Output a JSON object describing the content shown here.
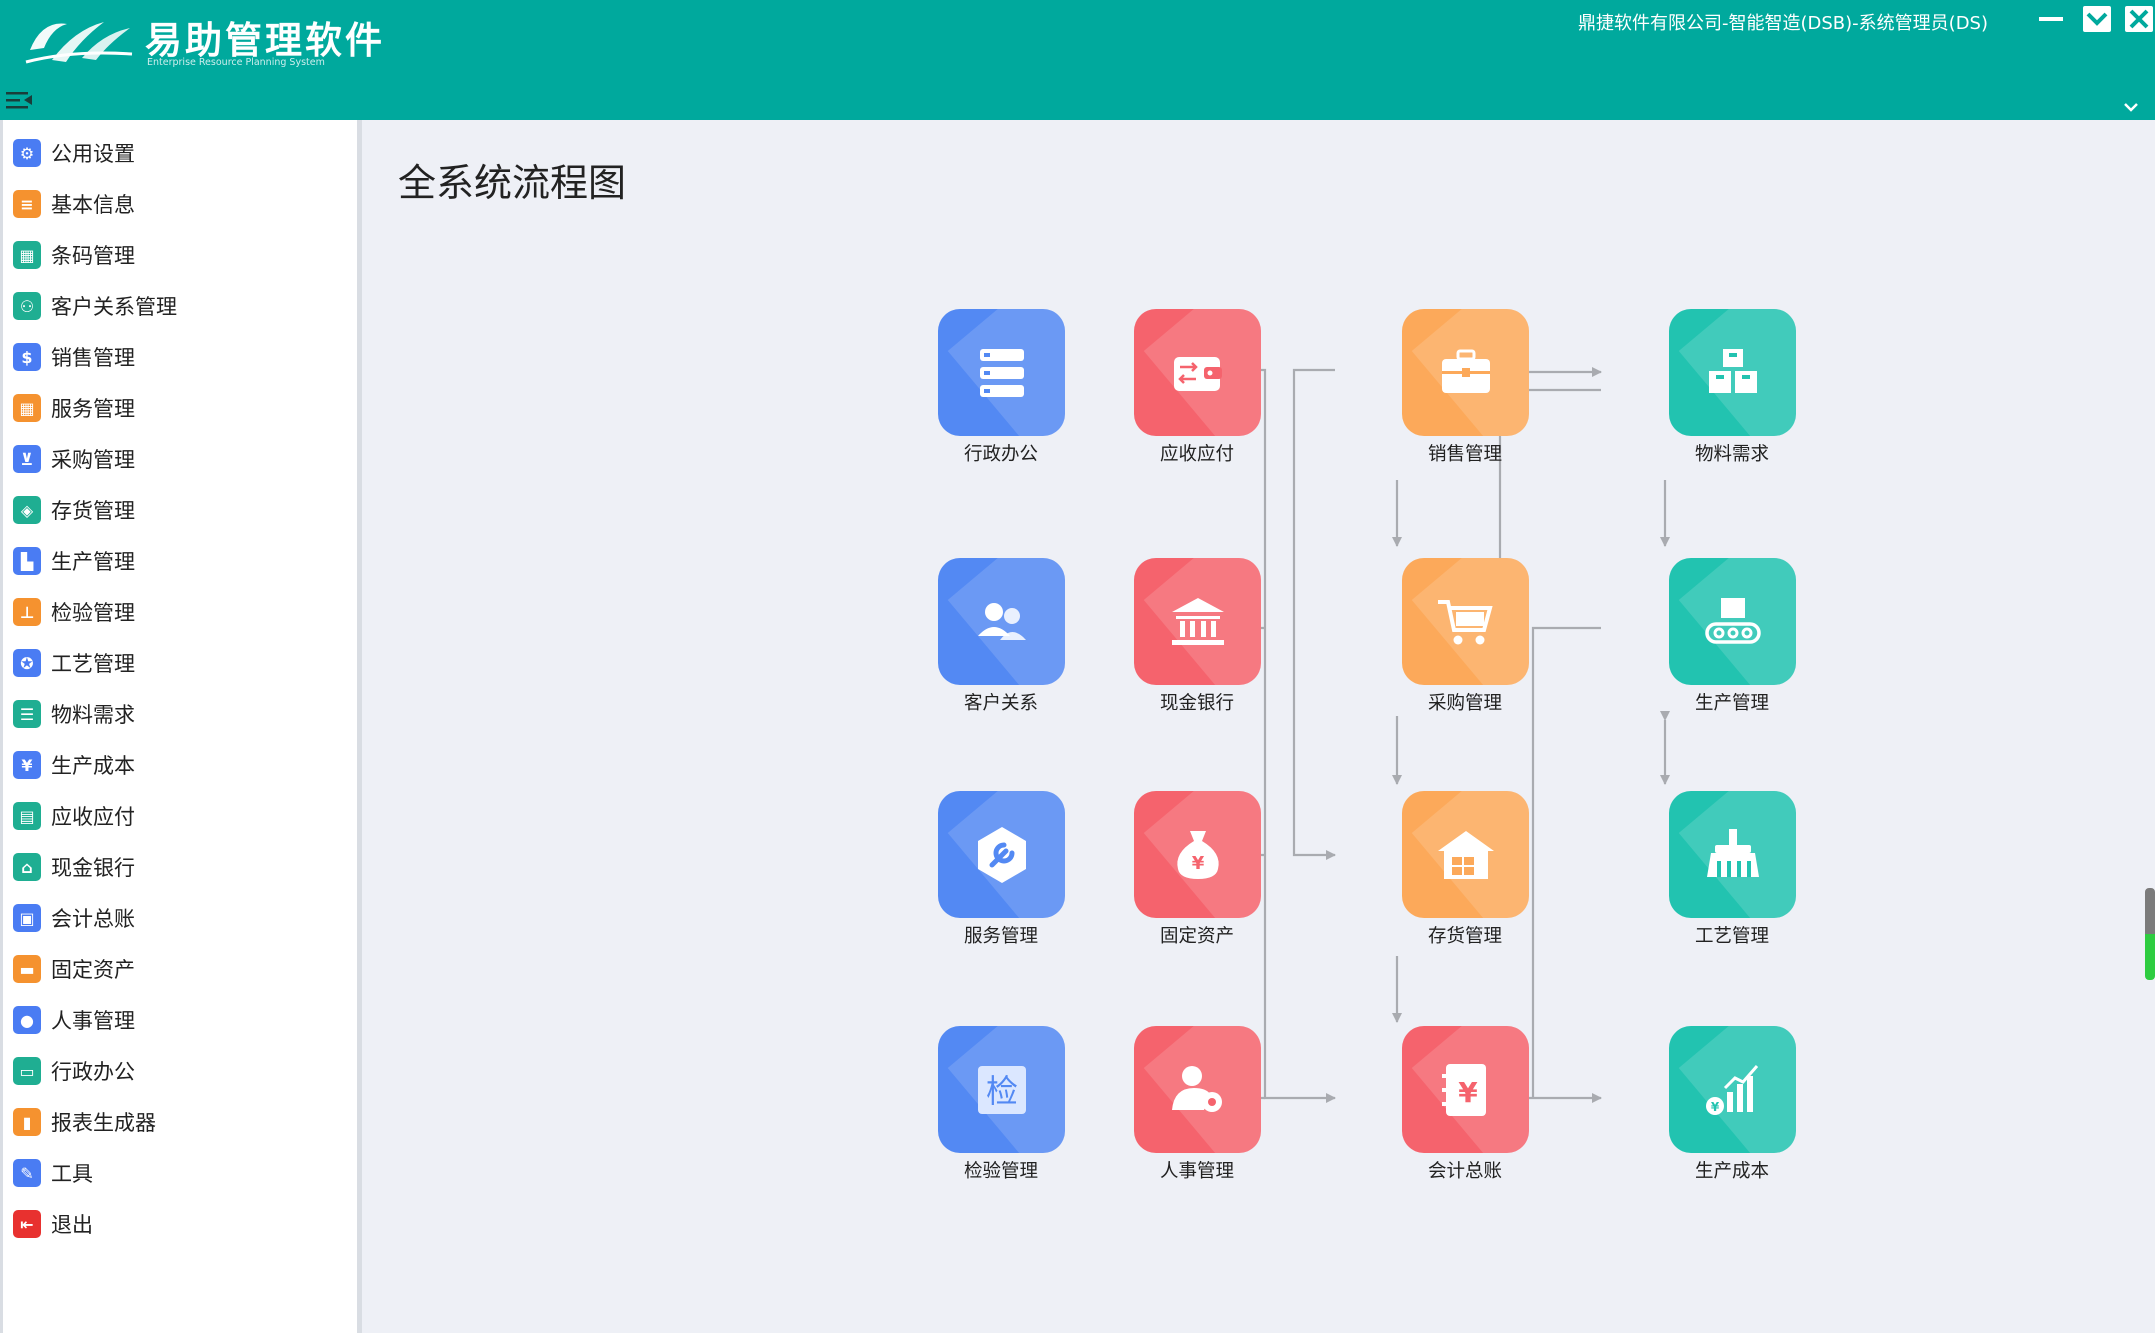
{
  "header": {
    "brand_title": "易助管理软件",
    "brand_subtitle": "Enterprise Resource Planning System",
    "user_info": "鼎捷软件有限公司-智能智造(DSB)-系统管理员(DS)",
    "bg_color": "#00a99d"
  },
  "sidebar": {
    "items": [
      {
        "label": "公用设置",
        "icon": "gear-icon",
        "color": "#4a7cf3"
      },
      {
        "label": "基本信息",
        "icon": "document-icon",
        "color": "#f5922f"
      },
      {
        "label": "条码管理",
        "icon": "barcode-grid-icon",
        "color": "#1fae92"
      },
      {
        "label": "客户关系管理",
        "icon": "people-icon",
        "color": "#1fae92"
      },
      {
        "label": "销售管理",
        "icon": "money-bag-icon",
        "color": "#4a7cf3"
      },
      {
        "label": "服务管理",
        "icon": "grid-dots-icon",
        "color": "#f5922f"
      },
      {
        "label": "采购管理",
        "icon": "cart-icon",
        "color": "#4a7cf3"
      },
      {
        "label": "存货管理",
        "icon": "box-icon",
        "color": "#1fae92"
      },
      {
        "label": "生产管理",
        "icon": "factory-icon",
        "color": "#4a7cf3"
      },
      {
        "label": "检验管理",
        "icon": "microscope-icon",
        "color": "#f5922f"
      },
      {
        "label": "工艺管理",
        "icon": "gears-icon",
        "color": "#4a7cf3"
      },
      {
        "label": "物料需求",
        "icon": "list-icon",
        "color": "#1fae92"
      },
      {
        "label": "生产成本",
        "icon": "yen-icon",
        "color": "#4a7cf3"
      },
      {
        "label": "应收应付",
        "icon": "calculator-icon",
        "color": "#1fae92"
      },
      {
        "label": "现金银行",
        "icon": "bank-icon",
        "color": "#1fae92"
      },
      {
        "label": "会计总账",
        "icon": "ledger-icon",
        "color": "#4a7cf3"
      },
      {
        "label": "固定资产",
        "icon": "briefcase-icon",
        "color": "#f5922f"
      },
      {
        "label": "人事管理",
        "icon": "person-icon",
        "color": "#4a7cf3"
      },
      {
        "label": "行政办公",
        "icon": "toolbox-icon",
        "color": "#1fae92"
      },
      {
        "label": "报表生成器",
        "icon": "bar-chart-icon",
        "color": "#f5922f"
      },
      {
        "label": "工具",
        "icon": "wrench-icon",
        "color": "#4a7cf3"
      },
      {
        "label": "退出",
        "icon": "exit-icon",
        "color": "#e8312f"
      }
    ]
  },
  "main": {
    "title": "全系统流程图",
    "modules": [
      {
        "label": "行政办公",
        "icon": "server-stack-icon",
        "color": "blue"
      },
      {
        "label": "应收应付",
        "icon": "wallet-icon",
        "color": "red"
      },
      {
        "label": "销售管理",
        "icon": "briefcase-icon",
        "color": "orange"
      },
      {
        "label": "物料需求",
        "icon": "boxes-icon",
        "color": "teal"
      },
      {
        "label": "客户关系",
        "icon": "people-icon",
        "color": "blue"
      },
      {
        "label": "现金银行",
        "icon": "bank-icon",
        "color": "red"
      },
      {
        "label": "采购管理",
        "icon": "cart-icon",
        "color": "orange"
      },
      {
        "label": "生产管理",
        "icon": "conveyor-icon",
        "color": "teal"
      },
      {
        "label": "服务管理",
        "icon": "wrench-hexagon-icon",
        "color": "blue"
      },
      {
        "label": "固定资产",
        "icon": "money-bag-icon",
        "color": "red"
      },
      {
        "label": "存货管理",
        "icon": "warehouse-icon",
        "color": "orange"
      },
      {
        "label": "工艺管理",
        "icon": "factory-icon",
        "color": "teal"
      },
      {
        "label": "检验管理",
        "icon": "inspect-icon",
        "color": "blue"
      },
      {
        "label": "人事管理",
        "icon": "person-gear-icon",
        "color": "red"
      },
      {
        "label": "会计总账",
        "icon": "ledger-yen-icon",
        "color": "red"
      },
      {
        "label": "生产成本",
        "icon": "cost-chart-icon",
        "color": "teal"
      }
    ],
    "inspect_glyph": "检",
    "yen_glyph": "¥"
  }
}
